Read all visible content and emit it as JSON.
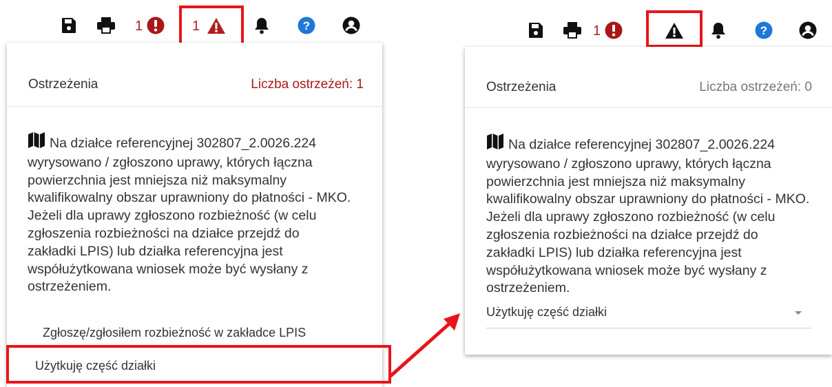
{
  "colors": {
    "accent_red": "#e8141b",
    "error_red": "#b11e1e",
    "help_blue": "#1e78d6",
    "icon_dark": "#111111",
    "muted_gray": "#777777"
  },
  "left": {
    "toolbar": {
      "icons": [
        "save-icon",
        "print-icon",
        "error-icon",
        "warning-icon",
        "bell-icon",
        "help-icon",
        "account-icon"
      ],
      "error_count": "1",
      "warning_count": "1"
    },
    "panel": {
      "title": "Ostrzeżenia",
      "count_label": "Liczba ostrzeżeń: 1",
      "message": "Na działce referencyjnej 302807_2.0026.224 wyrysowano / zgłoszono uprawy, których łączna powierzchnia jest mniejsza niż maksymalny kwalifikowalny obszar uprawniony do płatności - MKO. Jeżeli dla uprawy zgłoszono rozbieżność (w celu zgłoszenia rozbieżności na działce przejdź do zakładki LPIS) lub działka referencyjna jest współużytkowana wniosek może być wysłany z ostrzeżeniem.",
      "options": [
        "Zgłoszę/zgłosiłem rozbieżność w zakładce LPIS",
        "Użytkuję część działki"
      ]
    }
  },
  "right": {
    "toolbar": {
      "icons": [
        "save-icon",
        "print-icon",
        "error-icon",
        "warning-icon",
        "bell-icon",
        "help-icon",
        "account-icon"
      ],
      "error_count": "1"
    },
    "panel": {
      "title": "Ostrzeżenia",
      "count_label": "Liczba ostrzeżeń: 0",
      "message": "Na działce referencyjnej 302807_2.0026.224 wyrysowano / zgłoszono uprawy, których łączna powierzchnia jest mniejsza niż maksymalny kwalifikowalny obszar uprawniony do płatności - MKO. Jeżeli dla uprawy zgłoszono rozbieżność (w celu zgłoszenia rozbieżności na działce przejdź do zakładki LPIS) lub działka referencyjna jest współużytkowana wniosek może być wysłany z ostrzeżeniem.",
      "selected_value": "Użytkuję część działki"
    }
  }
}
